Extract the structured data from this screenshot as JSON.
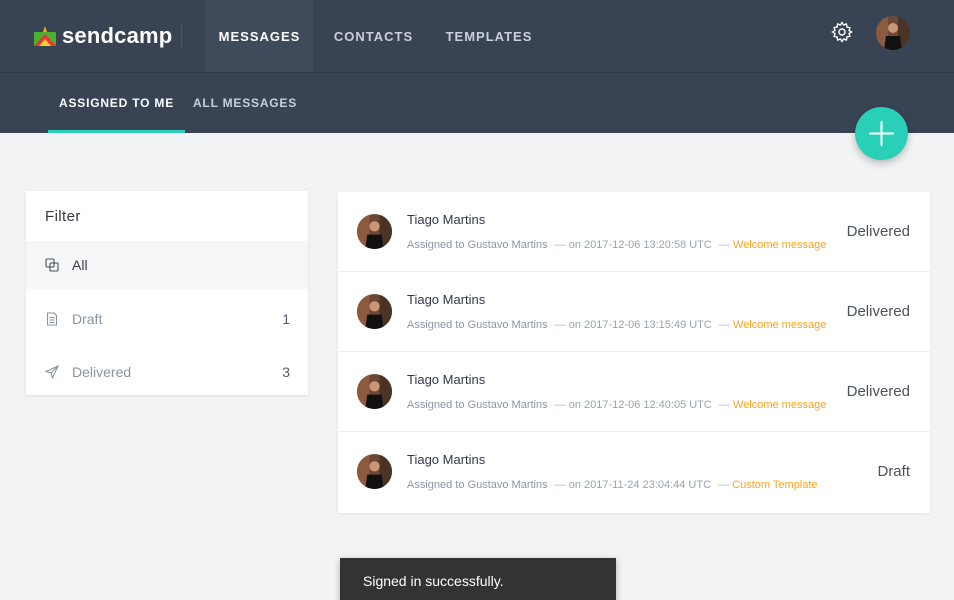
{
  "brand": {
    "name": "sendcamp",
    "logo_icon": "sendcamp-logo-icon",
    "accent": "#29cfb6"
  },
  "nav": {
    "tabs": [
      {
        "label": "MESSAGES",
        "active": true
      },
      {
        "label": "CONTACTS",
        "active": false
      },
      {
        "label": "TEMPLATES",
        "active": false
      }
    ],
    "settings_icon": "gear-icon",
    "avatar_icon": "user-avatar"
  },
  "subnav": {
    "tabs": [
      {
        "label": "ASSIGNED TO ME",
        "active": true
      },
      {
        "label": "ALL MESSAGES",
        "active": false
      }
    ]
  },
  "fab": {
    "icon": "plus-icon"
  },
  "filter": {
    "title": "Filter",
    "items": [
      {
        "label": "All",
        "count": "",
        "icon": "copy-icon",
        "active": true
      },
      {
        "label": "Draft",
        "count": "1",
        "icon": "document-icon",
        "active": false
      },
      {
        "label": "Delivered",
        "count": "3",
        "icon": "send-icon",
        "active": false
      }
    ]
  },
  "messages": [
    {
      "name": "Tiago Martins",
      "assigned": "Assigned to Gustavo Martins",
      "date": "on 2017-12-06 13:20:58 UTC",
      "template": "Welcome message",
      "status": "Delivered"
    },
    {
      "name": "Tiago Martins",
      "assigned": "Assigned to Gustavo Martins",
      "date": "on 2017-12-06 13:15:49 UTC",
      "template": "Welcome message",
      "status": "Delivered"
    },
    {
      "name": "Tiago Martins",
      "assigned": "Assigned to Gustavo Martins",
      "date": "on 2017-12-06 12:40:05 UTC",
      "template": "Welcome message",
      "status": "Delivered"
    },
    {
      "name": "Tiago Martins",
      "assigned": "Assigned to Gustavo Martins",
      "date": "on 2017-11-24 23:04:44 UTC",
      "template": "Custom Template",
      "status": "Draft"
    }
  ],
  "toast": {
    "text": "Signed in successfully."
  }
}
